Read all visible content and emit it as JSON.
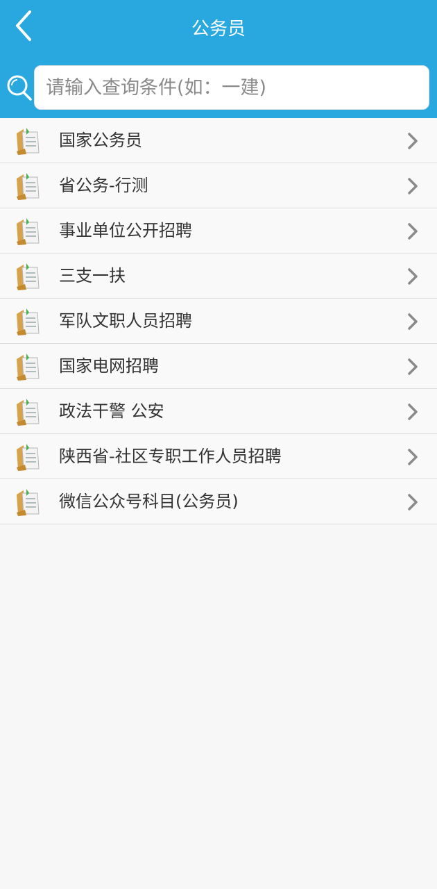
{
  "header": {
    "title": "公务员",
    "back_icon": "chevron-left-icon",
    "bg_color": "#29a8e0"
  },
  "search": {
    "placeholder": "请输入查询条件(如：一建)",
    "icon": "search-icon"
  },
  "list": {
    "item_icon": "document-folder-icon",
    "chevron_icon": "chevron-right-icon",
    "items": [
      {
        "label": "国家公务员"
      },
      {
        "label": "省公务-行测"
      },
      {
        "label": "事业单位公开招聘"
      },
      {
        "label": "三支一扶"
      },
      {
        "label": "军队文职人员招聘"
      },
      {
        "label": "国家电网招聘"
      },
      {
        "label": "政法干警 公安"
      },
      {
        "label": "陕西省-社区专职工作人员招聘"
      },
      {
        "label": "微信公众号科目(公务员)"
      }
    ]
  }
}
